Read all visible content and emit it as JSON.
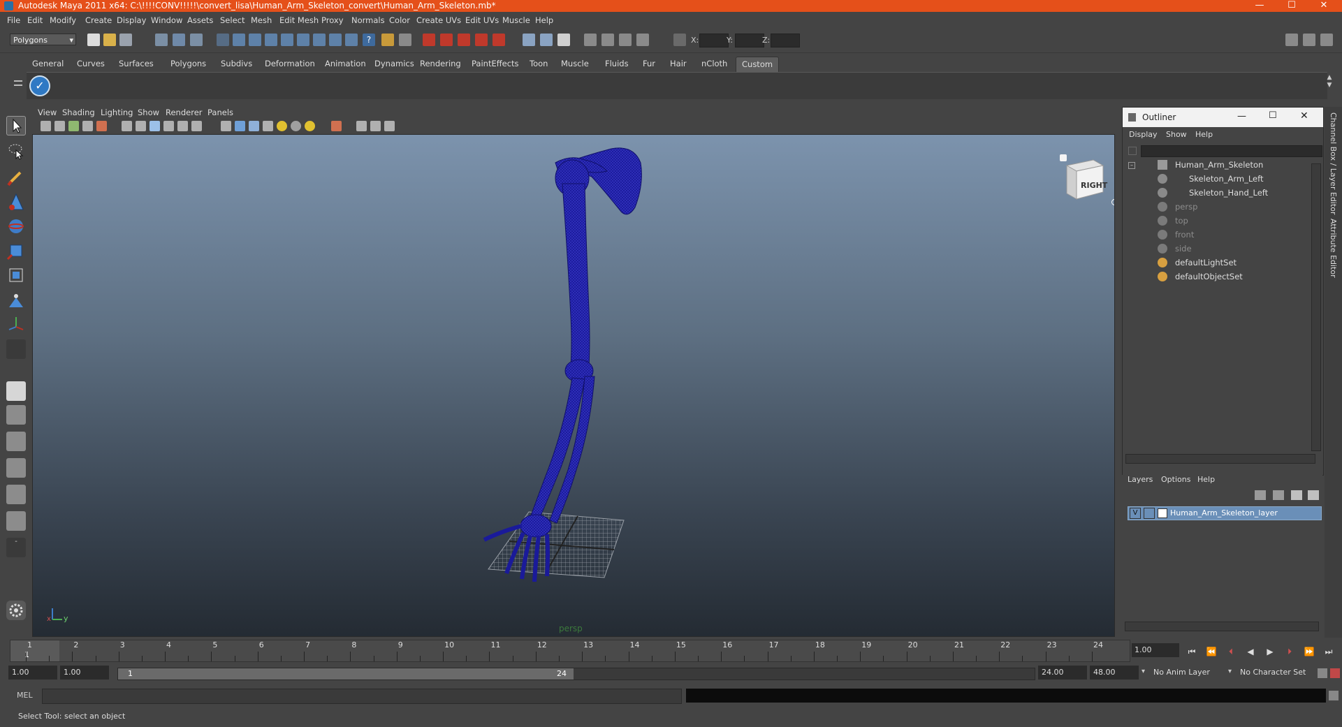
{
  "window": {
    "title": "Autodesk Maya 2011 x64: C:\\!!!!CONV!!!!!\\convert_lisa\\Human_Arm_Skeleton_convert\\Human_Arm_Skeleton.mb*",
    "minimize": "—",
    "maximize": "☐",
    "close": "✕"
  },
  "menu": [
    "File",
    "Edit",
    "Modify",
    "Create",
    "Display",
    "Window",
    "Assets",
    "Select",
    "Mesh",
    "Edit Mesh",
    "Proxy",
    "Normals",
    "Color",
    "Create UVs",
    "Edit UVs",
    "Muscle",
    "Help"
  ],
  "status_line": {
    "mode": "Polygons",
    "x_label": "X:",
    "y_label": "Y:",
    "z_label": "Z:"
  },
  "shelf": {
    "tabs": [
      "General",
      "Curves",
      "Surfaces",
      "Polygons",
      "Subdivs",
      "Deformation",
      "Animation",
      "Dynamics",
      "Rendering",
      "PaintEffects",
      "Toon",
      "Muscle",
      "Fluids",
      "Fur",
      "Hair",
      "nCloth",
      "Custom"
    ],
    "active_tab": "Custom"
  },
  "viewport": {
    "menu": [
      "View",
      "Shading",
      "Lighting",
      "Show",
      "Renderer",
      "Panels"
    ],
    "camera": "persp",
    "viewcube_face": "RIGHT",
    "axis_y": "y",
    "axis_x": "x"
  },
  "outliner": {
    "title": "Outliner",
    "menu": [
      "Display",
      "Show",
      "Help"
    ],
    "items": [
      {
        "label": "Human_Arm_Skeleton",
        "dim": false
      },
      {
        "label": "Skeleton_Arm_Left",
        "dim": false
      },
      {
        "label": "Skeleton_Hand_Left",
        "dim": false
      },
      {
        "label": "persp",
        "dim": true
      },
      {
        "label": "top",
        "dim": true
      },
      {
        "label": "front",
        "dim": true
      },
      {
        "label": "side",
        "dim": true
      },
      {
        "label": "defaultLightSet",
        "dim": false
      },
      {
        "label": "defaultObjectSet",
        "dim": false
      }
    ]
  },
  "layers": {
    "menu": [
      "Layers",
      "Options",
      "Help"
    ],
    "layer_visible": "V",
    "layer_name": "Human_Arm_Skeleton_layer"
  },
  "side_tabs": [
    "Channel Box / Layer Editor",
    "Attribute Editor"
  ],
  "timeline": {
    "ticks": [
      "1",
      "2",
      "3",
      "4",
      "5",
      "6",
      "7",
      "8",
      "9",
      "10",
      "11",
      "12",
      "13",
      "14",
      "15",
      "16",
      "17",
      "18",
      "19",
      "20",
      "21",
      "22",
      "23",
      "24"
    ],
    "current_frame_marker": "1",
    "current_frame": "1.00"
  },
  "range": {
    "start": "1.00",
    "playback_start": "1.00",
    "handle_start": "1",
    "handle_end": "24",
    "playback_end": "24.00",
    "end": "48.00",
    "anim_layer": "No Anim Layer",
    "character_set": "No Character Set"
  },
  "command": {
    "lang": "MEL"
  },
  "help_line": "Select Tool: select an object",
  "colors": {
    "titlebar": "#e5501a",
    "wire": "#14148c",
    "layer_selected": "#6a8fb8"
  }
}
